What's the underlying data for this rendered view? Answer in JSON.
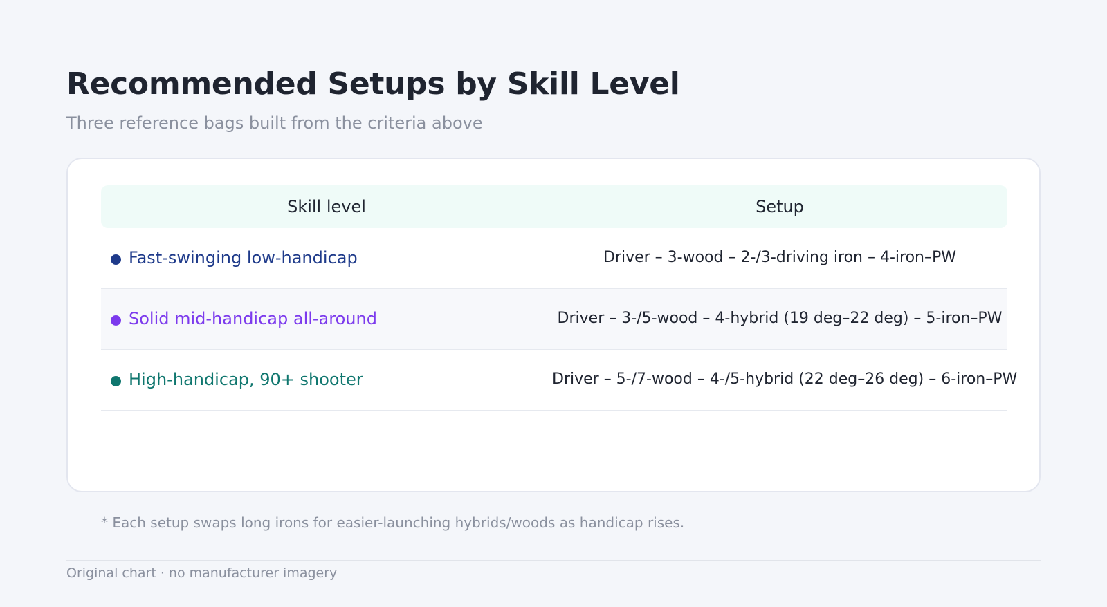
{
  "title": "Recommended Setups by Skill Level",
  "subtitle": "Three reference bags built from the criteria above",
  "chart_data": {
    "type": "table",
    "columns": [
      "Skill level",
      "Setup"
    ],
    "rows": [
      {
        "skill": "Fast-swinging low-handicap",
        "setup": "Driver – 3-wood – 2-/3-driving iron – 4-iron–PW",
        "color": "#1e3a8a"
      },
      {
        "skill": "Solid mid-handicap all-around",
        "setup": "Driver – 3-/5-wood – 4-hybrid (19 deg–22 deg) – 5-iron–PW",
        "color": "#7c3aed"
      },
      {
        "skill": "High-handicap, 90+ shooter",
        "setup": "Driver – 5-/7-wood – 4-/5-hybrid (22 deg–26 deg) – 6-iron–PW",
        "color": "#0f766e"
      }
    ]
  },
  "footnote": "* Each setup swaps long irons for easier-launching hybrids/woods as handicap rises.",
  "source_note": "Original chart · no manufacturer imagery"
}
